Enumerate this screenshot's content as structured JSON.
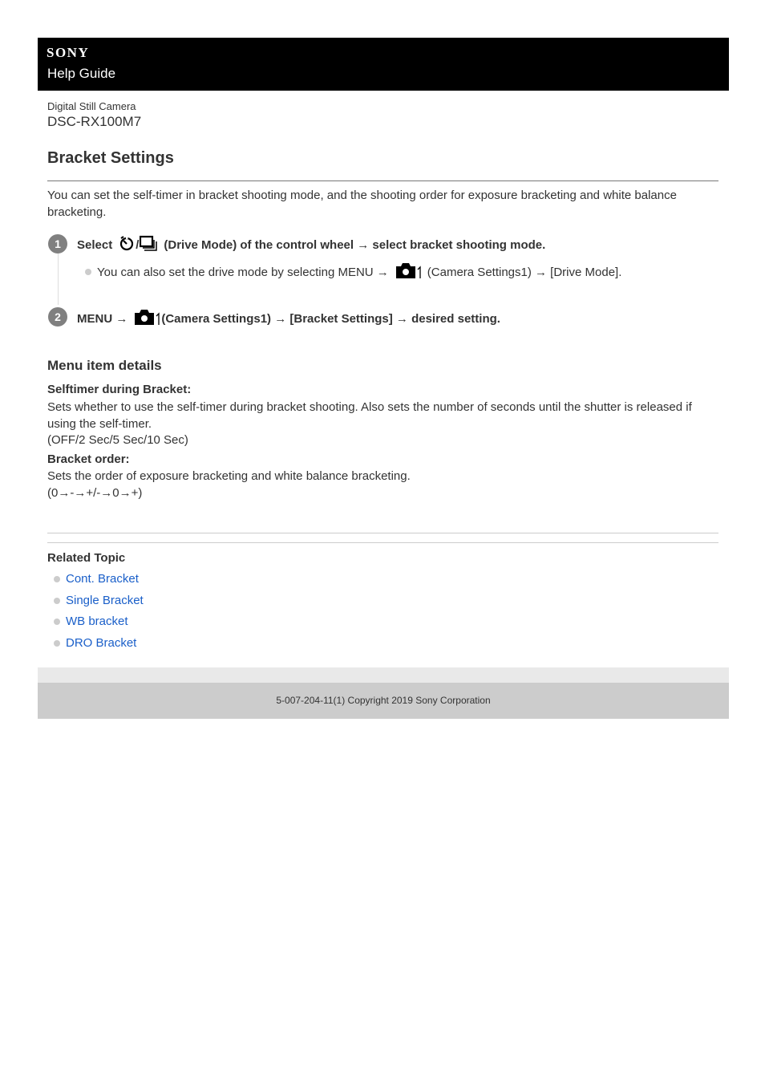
{
  "header": {
    "brand": "SONY",
    "title": "Help Guide"
  },
  "product": {
    "type": "Digital Still Camera",
    "model": "DSC-RX100M7"
  },
  "page": {
    "title": "Bracket Settings",
    "intro": "You can set the self-timer in bracket shooting mode, and the shooting order for exposure bracketing and white balance bracketing."
  },
  "steps": [
    {
      "number": "1",
      "prefix": "Select",
      "icons": [
        "self-timer-icon",
        "continuous-shooting-icon"
      ],
      "separator": "/",
      "suffix": "(Drive Mode) of the control wheel → select bracket shooting mode.",
      "note": {
        "prefix": "You can also set the drive mode by selecting MENU →",
        "icon": "camera-settings1-icon",
        "suffix": "(Camera Settings1) → [Drive Mode]."
      }
    },
    {
      "number": "2",
      "prefix": "MENU →",
      "icon": "camera-settings1-icon",
      "suffix": "(Camera Settings1) → [Bracket Settings] → desired setting."
    }
  ],
  "details": {
    "title": "Menu item details",
    "items": [
      {
        "term": "Selftimer during Bracket:",
        "description": "Sets whether to use the self-timer during bracket shooting. Also sets the number of seconds until the shutter is released if using the self-timer.",
        "options": "(OFF/2 Sec/5 Sec/10 Sec)"
      },
      {
        "term": "Bracket order:",
        "description": "Sets the order of exposure bracketing and white balance bracketing.",
        "options": "(0→-→+/-→0→+)"
      }
    ]
  },
  "related": {
    "title": "Related Topic",
    "links": [
      "Cont. Bracket",
      "Single Bracket",
      "WB bracket",
      "DRO Bracket"
    ]
  },
  "footer": {
    "copyright": "5-007-204-11(1) Copyright 2019 Sony Corporation"
  },
  "colors": {
    "link": "#1a5fc9",
    "header_bg": "#000000",
    "footer_bg": "#cccccc"
  }
}
